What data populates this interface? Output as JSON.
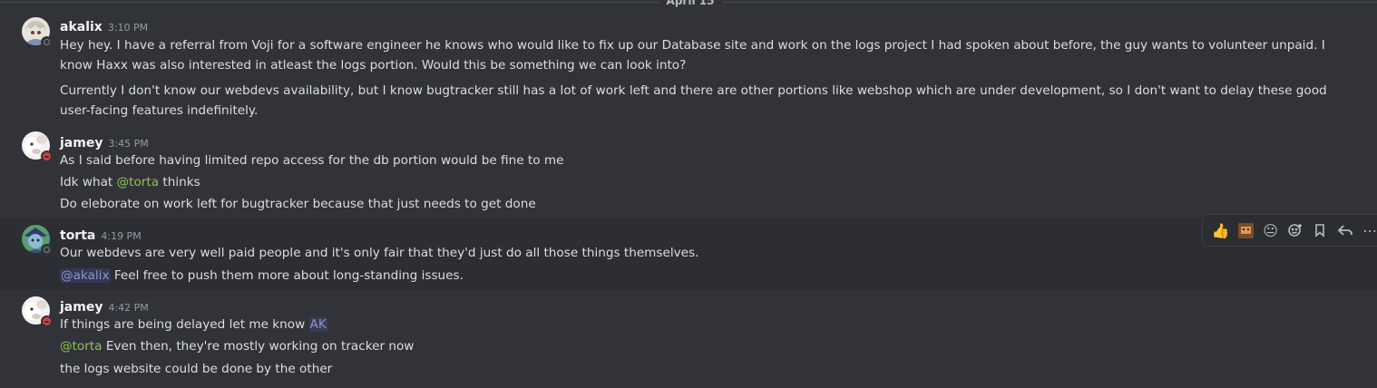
{
  "day_divider": "April 15",
  "messages": [
    {
      "username": "akalix",
      "time": "3:10 PM",
      "status": "offline",
      "lines": [
        "Hey hey. I have a referral from Voji for a software engineer he knows who would like to fix up our Database site and work on the logs project I had spoken about before, the guy wants to volunteer unpaid. I know Haxx was also interested in atleast the logs portion. Would this be something we can look into?",
        "Currently I don't know our webdevs availability, but I know bugtracker still has a lot of work left and there are other portions like webshop which are under development, so I don't want to delay these good user-facing features indefinitely."
      ]
    },
    {
      "username": "jamey",
      "time": "3:45 PM",
      "status": "dnd",
      "lines": [
        "As I said before having limited repo access for the db portion would be fine to me",
        {
          "before": "Idk what ",
          "mention": "@torta",
          "after": " thinks"
        },
        "Do eleborate on work left for bugtracker because that just needs to get done"
      ]
    },
    {
      "username": "torta",
      "time": "4:19 PM",
      "status": "offline",
      "lines": [
        "Our webdevs are very well paid people and it's only fair that they'd just do all those things themselves.",
        {
          "mention": "@akalix",
          "after": " Feel free to push them more about long-standing issues."
        }
      ]
    },
    {
      "username": "jamey",
      "time": "4:42 PM",
      "status": "dnd",
      "lines": [
        {
          "before": "If things are being delayed let me know ",
          "role": "AK"
        },
        {
          "mention": "@torta",
          "after": " Even then, they're mostly working on tracker now"
        },
        "the logs website could be done by the other"
      ]
    }
  ],
  "toolbar": [
    {
      "name": "thumbs-up-reaction-icon",
      "glyph": "👍"
    },
    {
      "name": "custom-emoji-reaction-icon",
      "glyph": "▩"
    },
    {
      "name": "neutral-face-reaction-icon",
      "glyph": "😐"
    },
    {
      "name": "add-reaction-icon",
      "glyph": "☺"
    },
    {
      "name": "bookmark-icon",
      "glyph": "🔖"
    },
    {
      "name": "reply-icon",
      "glyph": "↩"
    },
    {
      "name": "more-options-icon",
      "glyph": "⋯"
    }
  ]
}
